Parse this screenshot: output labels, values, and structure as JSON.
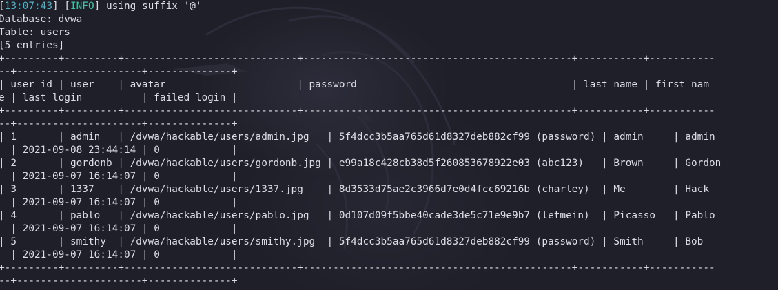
{
  "log": {
    "timestamp": "13:07:43",
    "level": "INFO",
    "message": " using suffix '@'"
  },
  "header_lines": [
    "Database: dvwa",
    "Table: users",
    "[5 entries]"
  ],
  "table_lines": [
    "+---------+---------+-----------------------------+---------------------------------------------+-----------+-----------",
    "--+---------------------+--------------+",
    "| user_id | user    | avatar                      | password                                    | last_name | first_nam",
    "e | last_login          | failed_login |",
    "+---------+---------+-----------------------------+---------------------------------------------+-----------+-----------",
    "--+---------------------+--------------+",
    "| 1       | admin   | /dvwa/hackable/users/admin.jpg   | 5f4dcc3b5aa765d61d8327deb882cf99 (password) | admin     | admin",
    "  | 2021-09-08 23:44:14 | 0            |",
    "| 2       | gordonb | /dvwa/hackable/users/gordonb.jpg | e99a18c428cb38d5f260853678922e03 (abc123)   | Brown     | Gordon",
    "  | 2021-09-07 16:14:07 | 0            |",
    "| 3       | 1337    | /dvwa/hackable/users/1337.jpg    | 8d3533d75ae2c3966d7e0d4fcc69216b (charley)  | Me        | Hack",
    "  | 2021-09-07 16:14:07 | 0            |",
    "| 4       | pablo   | /dvwa/hackable/users/pablo.jpg   | 0d107d09f5bbe40cade3de5c71e9e9b7 (letmein)  | Picasso   | Pablo",
    "  | 2021-09-07 16:14:07 | 0            |",
    "| 5       | smithy  | /dvwa/hackable/users/smithy.jpg  | 5f4dcc3b5aa765d61d8327deb882cf99 (password) | Smith     | Bob",
    "  | 2021-09-07 16:14:07 | 0            |",
    "+---------+---------+-----------------------------+---------------------------------------------+-----------+-----------",
    "--+---------------------+--------------+"
  ],
  "colors": {
    "background": "#1f1f29",
    "text": "#dcdde4",
    "timestamp": "#4fb3c4",
    "info": "#43c3a6"
  }
}
